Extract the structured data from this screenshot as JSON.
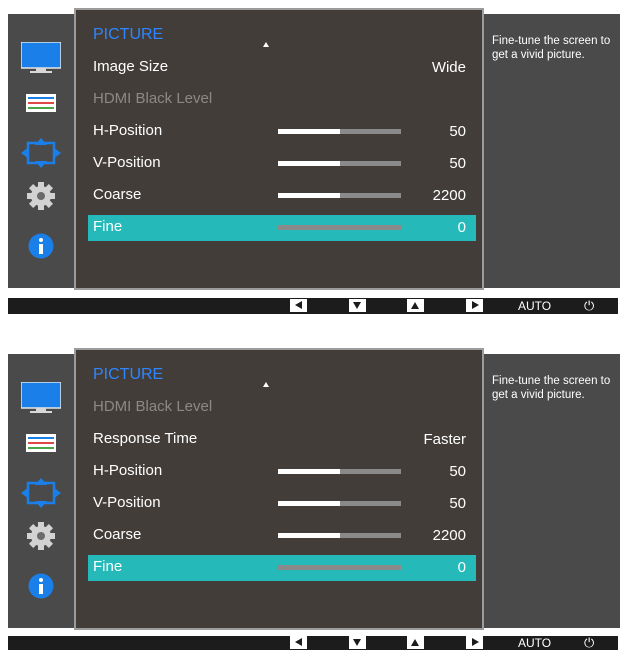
{
  "panels": [
    {
      "title": "PICTURE",
      "help": "Fine-tune the screen to get a vivid picture.",
      "items": [
        {
          "label": "Image Size",
          "value": "Wide",
          "dimmed": false,
          "selected": false
        },
        {
          "label": "HDMI Black Level",
          "value": "",
          "dimmed": true,
          "selected": false
        },
        {
          "label": "H-Position",
          "value": "50",
          "dimmed": false,
          "selected": false,
          "level": 0.5
        },
        {
          "label": "V-Position",
          "value": "50",
          "dimmed": false,
          "selected": false,
          "level": 0.5
        },
        {
          "label": "Coarse",
          "value": "2200",
          "dimmed": false,
          "selected": false,
          "level": 0.5
        },
        {
          "label": "Fine",
          "value": "0",
          "dimmed": false,
          "selected": true,
          "level": 0
        }
      ]
    },
    {
      "title": "PICTURE",
      "help": "Fine-tune the screen to get a vivid picture.",
      "items": [
        {
          "label": "HDMI Black Level",
          "value": "",
          "dimmed": true,
          "selected": false
        },
        {
          "label": "Response Time",
          "value": "Faster",
          "dimmed": false,
          "selected": false
        },
        {
          "label": "H-Position",
          "value": "50",
          "dimmed": false,
          "selected": false,
          "level": 0.5
        },
        {
          "label": "V-Position",
          "value": "50",
          "dimmed": false,
          "selected": false,
          "level": 0.5
        },
        {
          "label": "Coarse",
          "value": "2200",
          "dimmed": false,
          "selected": false,
          "level": 0.5
        },
        {
          "label": "Fine",
          "value": "0",
          "dimmed": false,
          "selected": true,
          "level": 0
        }
      ]
    }
  ],
  "footer": {
    "auto_label": "AUTO",
    "power_symbol": "⏻"
  },
  "sidebar_icons": [
    "monitor-icon",
    "color-bars-icon",
    "resize-arrows-icon",
    "gear-icon",
    "info-icon"
  ],
  "colors": {
    "title": "#2f86ff",
    "selected": "#25b9b9",
    "menu_bg": "#423d39",
    "frame": "#9c9c9c"
  }
}
